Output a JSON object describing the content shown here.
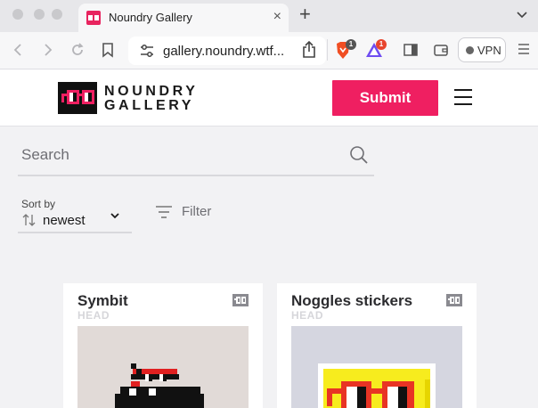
{
  "browser": {
    "tab_title": "Noundry Gallery",
    "tab_close": "×",
    "new_tab": "+",
    "url": "gallery.noundry.wtf...",
    "vpn_label": "VPN",
    "brave_badge": "1",
    "rewards_badge": "1"
  },
  "site": {
    "logo_line1": "NOUNDRY",
    "logo_line2": "GALLERY",
    "submit_label": "Submit"
  },
  "controls": {
    "search_placeholder": "Search",
    "sort_caption": "Sort by",
    "sort_value": "newest",
    "filter_label": "Filter"
  },
  "cards": [
    {
      "title": "Symbit",
      "type": "HEAD",
      "image_bg": "#e1dad7"
    },
    {
      "title": "Noggles stickers",
      "type": "HEAD",
      "image_bg": "#d5d6e0"
    }
  ],
  "colors": {
    "accent": "#ef1f61",
    "page_bg": "#f2f2f4"
  },
  "icons": [
    "back-icon",
    "forward-icon",
    "reload-icon",
    "bookmark-icon",
    "site-settings-icon",
    "share-icon",
    "brave-shields-icon",
    "brave-rewards-icon",
    "sidebar-icon",
    "wallet-icon",
    "menu-icon",
    "search-icon",
    "sort-icon",
    "chevron-down-icon",
    "filter-icon",
    "hamburger-icon",
    "noggles-icon"
  ]
}
